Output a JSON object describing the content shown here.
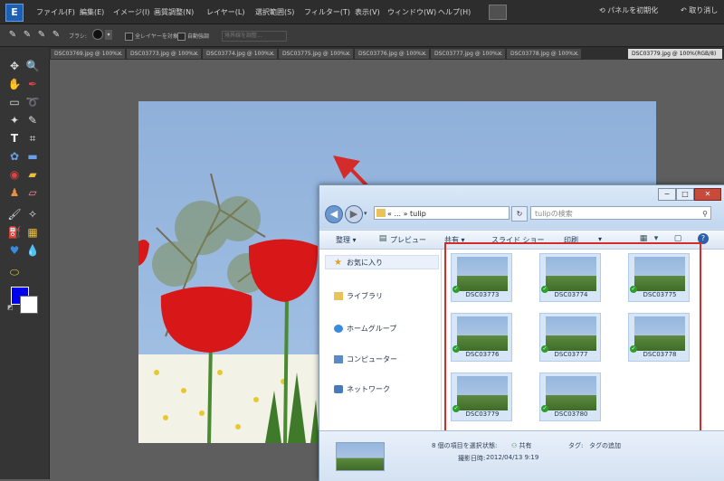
{
  "menubar": {
    "items": [
      "ファイル(F)",
      "編集(E)",
      "イメージ(I)",
      "画質調整(N)",
      "レイヤー(L)",
      "選択範囲(S)",
      "フィルター(T)",
      "表示(V)",
      "ウィンドウ(W)",
      "ヘルプ(H)"
    ],
    "reset_panels": "パネルを初期化",
    "undo": "取り消し"
  },
  "options": {
    "brush_label": "ブラシ:",
    "sample_all_layers": "全レイヤーを対象",
    "auto_enhance": "自動強調",
    "refine_edge": "境界線を調整..."
  },
  "tabs": [
    "DSC03769.jpg @ 100%...",
    "DSC03773.jpg @ 100%...",
    "DSC03774.jpg @ 100%...",
    "DSC03775.jpg @ 100%...",
    "DSC03776.jpg @ 100%...",
    "DSC03777.jpg @ 100%...",
    "DSC03778.jpg @ 100%...",
    "DSC03779.jpg @ 100%(RGB/8)"
  ],
  "colors": {
    "foreground": "#0000f0",
    "background": "#ffffff",
    "annotation": "#d42b2b"
  },
  "explorer": {
    "address": "« ... » tulip",
    "search_placeholder": "tulipの検索",
    "commands": {
      "organize": "整理 ▾",
      "preview": "プレビュー",
      "share": "共有 ▾",
      "slideshow": "スライド ショー",
      "print": "印刷"
    },
    "nav": [
      "お気に入り",
      "ライブラリ",
      "ホームグループ",
      "コンピューター",
      "ネットワーク"
    ],
    "files": [
      "DSC03773",
      "DSC03774",
      "DSC03775",
      "DSC03776",
      "DSC03777",
      "DSC03778",
      "DSC03779",
      "DSC03780"
    ],
    "details": {
      "selected": "8 個の項目を選択",
      "state_label": "状態:",
      "state_value": "共有",
      "tag_label": "タグ:",
      "tag_value": "タグの追加",
      "date_label": "撮影日時:",
      "date_value": "2012/04/13 9:19"
    }
  }
}
